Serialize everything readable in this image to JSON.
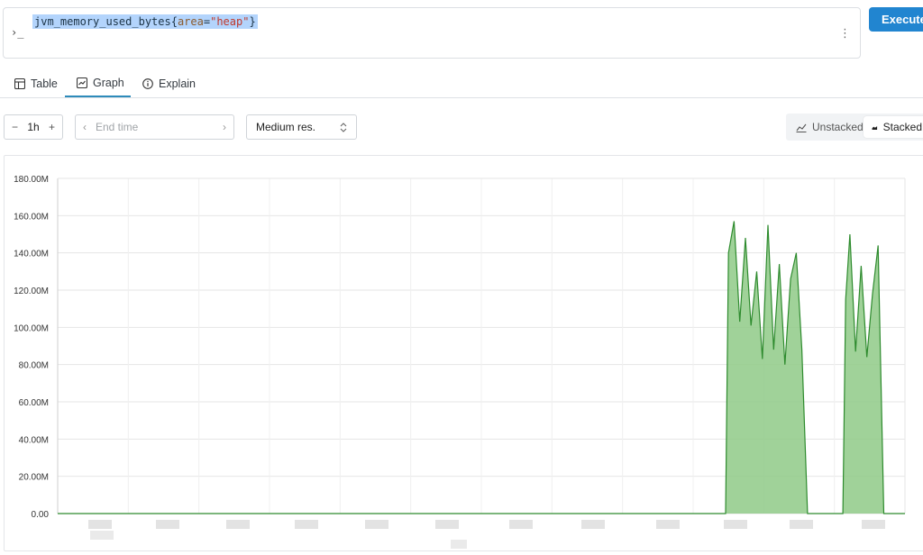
{
  "query": {
    "metric": "jvm_memory_used_bytes",
    "open_brace": "{",
    "label_name": "area",
    "equals": "=",
    "label_value": "\"heap\"",
    "close_brace": "}",
    "prompt_symbol": "›_"
  },
  "execute_label": "Execute",
  "tabs": [
    {
      "label": "Table",
      "icon": "table-icon"
    },
    {
      "label": "Graph",
      "icon": "graph-icon",
      "active": true
    },
    {
      "label": "Explain",
      "icon": "info-icon"
    }
  ],
  "controls": {
    "range_value": "1h",
    "minus": "−",
    "plus": "+",
    "end_time_placeholder": "End time",
    "resolution": "Medium res.",
    "unstacked": "Unstacked",
    "stacked": "Stacked"
  },
  "colors": {
    "series_line": "#2e8b2e",
    "series_fill": "#8fca87",
    "execute": "#2185d0",
    "tab_active": "#2e8bba"
  },
  "chart_data": {
    "type": "area",
    "y_tick_labels": [
      "0.00",
      "20.00M",
      "40.00M",
      "60.00M",
      "80.00M",
      "100.00M",
      "120.00M",
      "140.00M",
      "160.00M",
      "180.00M"
    ],
    "ylim": [
      0,
      180000000
    ],
    "xlim": [
      0,
      60
    ],
    "x_tick_labels_obscured": true,
    "grid": true,
    "series": [
      {
        "values_x": [
          47.3,
          47.5,
          47.9,
          48.3,
          48.7,
          49.1,
          49.5,
          49.9,
          50.3,
          50.7,
          51.1,
          51.5,
          51.9,
          52.3,
          52.7,
          53.1,
          53.4,
          53.6,
          53.8,
          55.6,
          55.8,
          56.1,
          56.5,
          56.9,
          57.3,
          57.7,
          58.1,
          58.5,
          58.8,
          59.0
        ],
        "values_y": [
          0,
          140000000,
          157000000,
          103000000,
          148000000,
          101000000,
          130000000,
          83000000,
          155000000,
          88000000,
          134000000,
          80000000,
          126000000,
          140000000,
          88000000,
          0,
          0,
          0,
          0,
          0,
          115000000,
          150000000,
          87000000,
          133000000,
          84000000,
          118000000,
          144000000,
          0,
          0,
          0
        ]
      }
    ]
  }
}
